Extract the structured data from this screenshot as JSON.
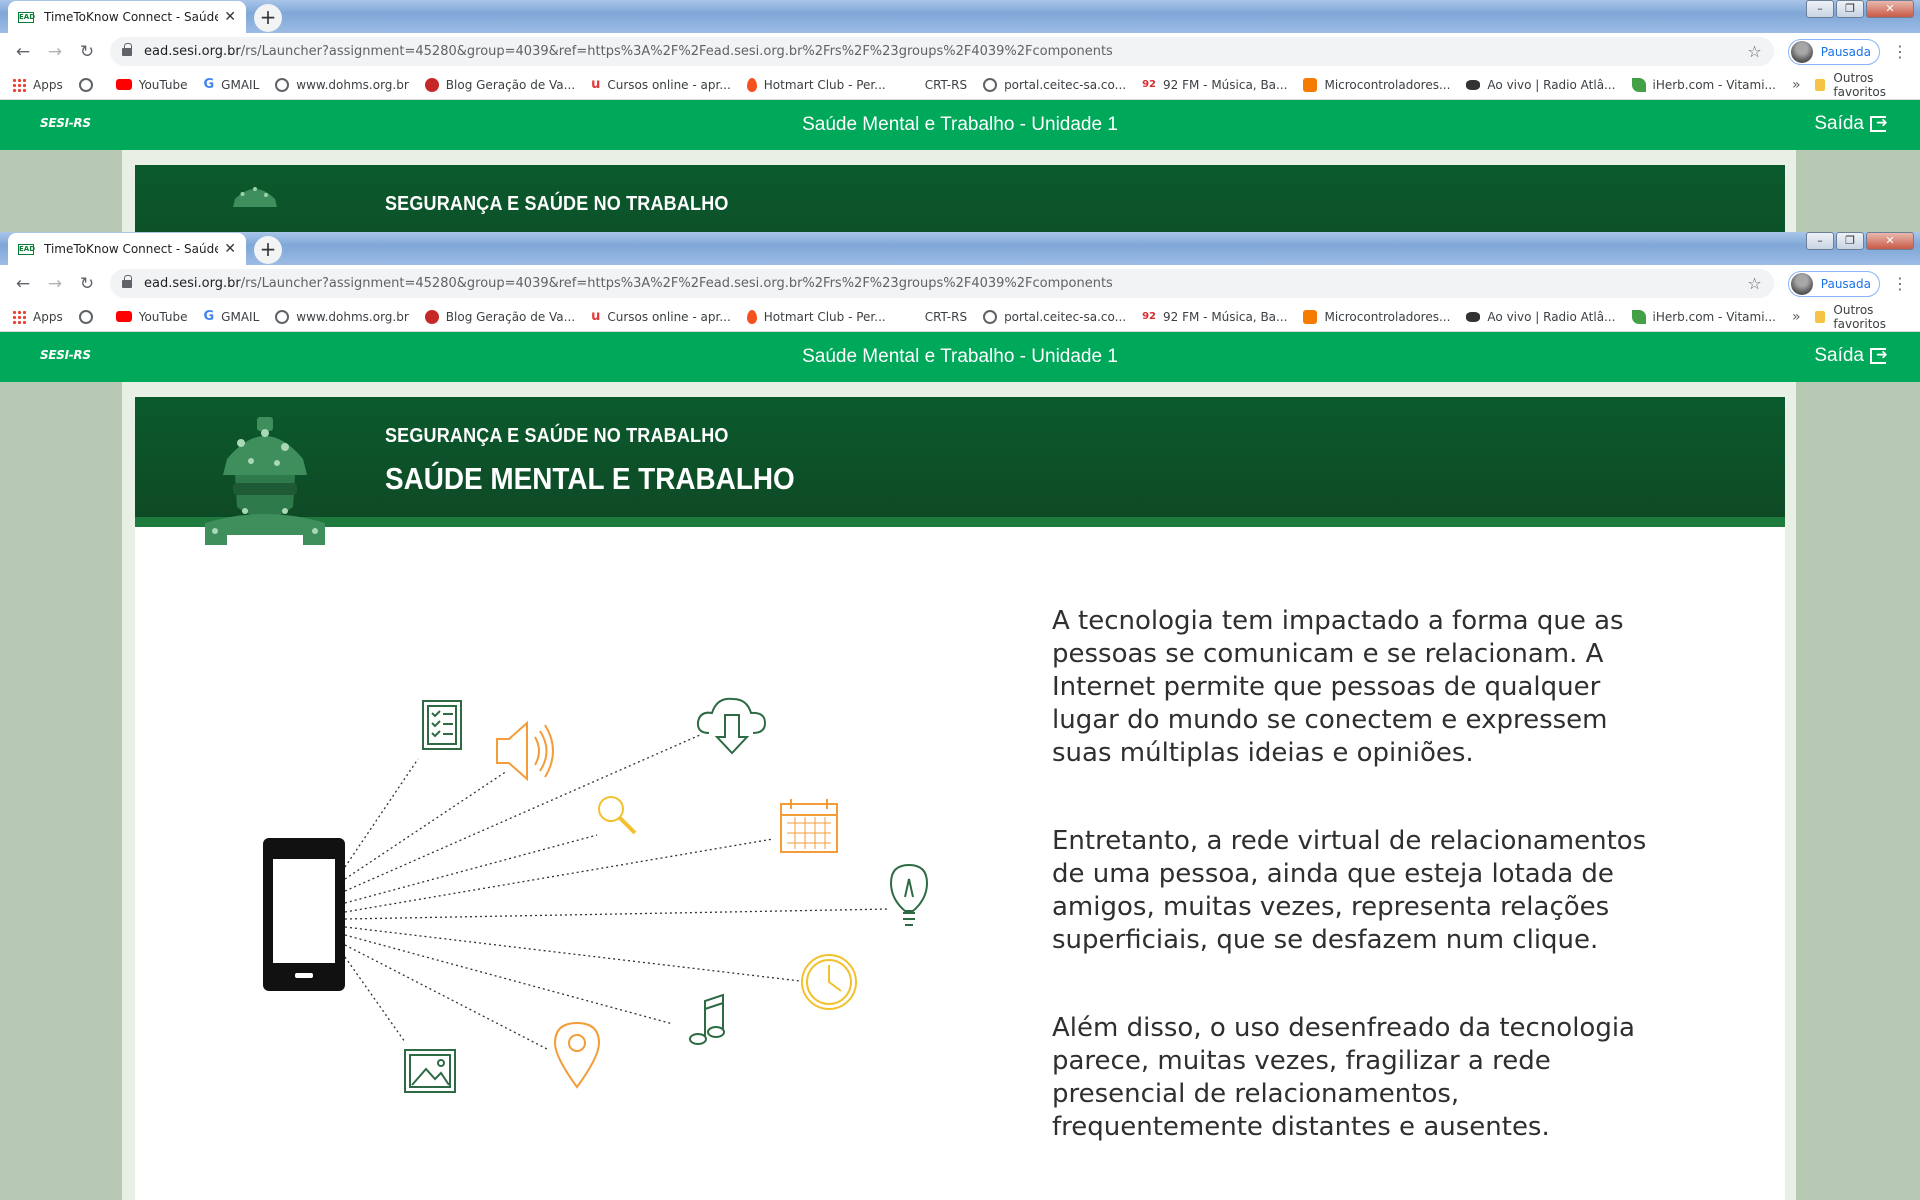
{
  "browser": {
    "tab_title": "TimeToKnow Connect - Saúde M",
    "tab_favicon": "EAD",
    "new_tab_symbol": "+",
    "url_domain": "ead.sesi.org.br",
    "url_path": "/rs/Launcher?assignment=45280&group=4039&ref=https%3A%2F%2Fead.sesi.org.br%2Frs%2F%23groups%2F4039%2Fcomponents",
    "profile_label": "Pausada",
    "bookmarks": [
      {
        "label": "Apps",
        "icon": "apps-grid-icon"
      },
      {
        "label": "",
        "icon": "globe-icon"
      },
      {
        "label": "YouTube",
        "icon": "youtube-icon"
      },
      {
        "label": "GMAIL",
        "icon": "google-icon"
      },
      {
        "label": "www.dohms.org.br",
        "icon": "globe-icon"
      },
      {
        "label": "Blog Geração de Va...",
        "icon": "clover-icon"
      },
      {
        "label": "Cursos online - apr...",
        "icon": "udemy-icon"
      },
      {
        "label": "Hotmart Club - Per...",
        "icon": "flame-icon"
      },
      {
        "label": "CRT-RS",
        "icon": "blank-icon"
      },
      {
        "label": "portal.ceitec-sa.co...",
        "icon": "globe-icon"
      },
      {
        "label": "92 FM - Música, Ba...",
        "icon": "radio92-icon"
      },
      {
        "label": "Microcontroladores...",
        "icon": "blogger-icon"
      },
      {
        "label": "Ao vivo | Radio Atlâ...",
        "icon": "radio-icon"
      },
      {
        "label": "iHerb.com - Vitami...",
        "icon": "leaf-icon"
      }
    ],
    "bookmarks_more": "»",
    "other_bookmarks": "Outros favoritos"
  },
  "app": {
    "logo": "SESI-RS",
    "title": "Saúde Mental e Trabalho - Unidade 1",
    "exit_label": "Saída"
  },
  "banner": {
    "subtitle": "SEGURANÇA E SAÚDE NO TRABALHO",
    "title": "SAÚDE MENTAL E TRABALHO"
  },
  "body": {
    "paragraphs": [
      "A tecnologia tem impactado a forma que as pessoas se comunicam e se relacionam. A Internet permite que pessoas de qualquer lugar do mundo se conectem e  expressem suas  múltiplas ideias e opiniões.",
      "Entretanto, a rede virtual de relacionamentos de uma pessoa, ainda que esteja lotada de amigos, muitas vezes, representa relações superficiais, que se desfazem num clique.",
      "Além disso, o uso desenfreado da tecnologia parece, muitas vezes, fragilizar a rede presencial de relacionamentos, frequentemente distantes e ausentes."
    ]
  },
  "illustration": {
    "icons": [
      "checklist-icon",
      "speaker-icon",
      "cloud-download-icon",
      "magnifier-icon",
      "calendar-icon",
      "lightbulb-icon",
      "clock-icon",
      "music-note-icon",
      "location-pin-icon",
      "image-icon"
    ],
    "colors": {
      "green": "#2e6b45",
      "orange": "#f39c38",
      "yellow": "#f2c12e",
      "phone": "#111111"
    }
  }
}
